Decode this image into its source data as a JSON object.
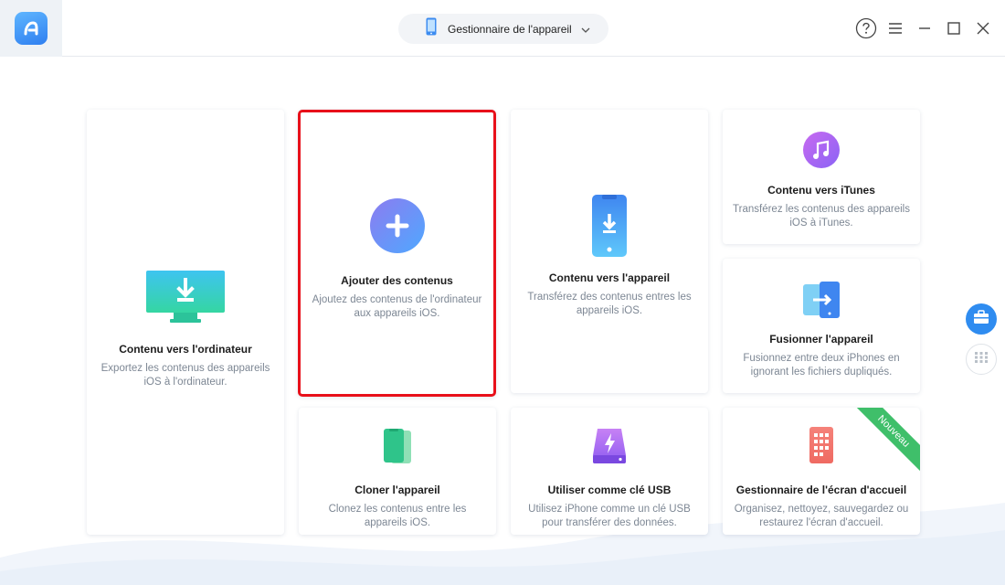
{
  "window": {
    "device_selector_label": "Gestionnaire de l'appareil"
  },
  "icons": {
    "logo": "anytrans-logo-icon",
    "phone": "phone-icon",
    "chevron": "chevron-down-icon",
    "help": "help-icon",
    "menu": "menu-icon",
    "minimize": "minimize-icon",
    "maximize": "maximize-icon",
    "close": "close-icon",
    "toolbox": "toolbox-icon",
    "apps": "apps-grid-icon"
  },
  "cards": {
    "to_computer": {
      "title": "Contenu vers l'ordinateur",
      "desc": "Exportez les contenus des appareils iOS à l'ordinateur."
    },
    "add_content": {
      "title": "Ajouter des contenus",
      "desc": "Ajoutez des contenus de l'ordinateur aux appareils iOS."
    },
    "to_device": {
      "title": "Contenu vers l'appareil",
      "desc": "Transférez des contenus entres les appareils iOS."
    },
    "to_itunes": {
      "title": "Contenu vers iTunes",
      "desc": "Transférez les contenus des appareils iOS à iTunes."
    },
    "merge": {
      "title": "Fusionner l'appareil",
      "desc": "Fusionnez entre deux iPhones en ignorant les fichiers dupliqués."
    },
    "clone": {
      "title": "Cloner l'appareil",
      "desc": "Clonez les contenus entre les appareils iOS."
    },
    "usb": {
      "title": "Utiliser comme clé USB",
      "desc": "Utilisez iPhone comme un clé USB pour transférer des données."
    },
    "home_screen": {
      "title": "Gestionnaire de l'écran d'accueil",
      "desc": "Organisez, nettoyez, sauvegardez ou restaurez l'écran d'accueil.",
      "badge": "Nouveau"
    }
  },
  "colors": {
    "selected_border": "#e8101a",
    "accent_blue": "#2f7ff0",
    "new_badge": "#3fbf6a"
  }
}
